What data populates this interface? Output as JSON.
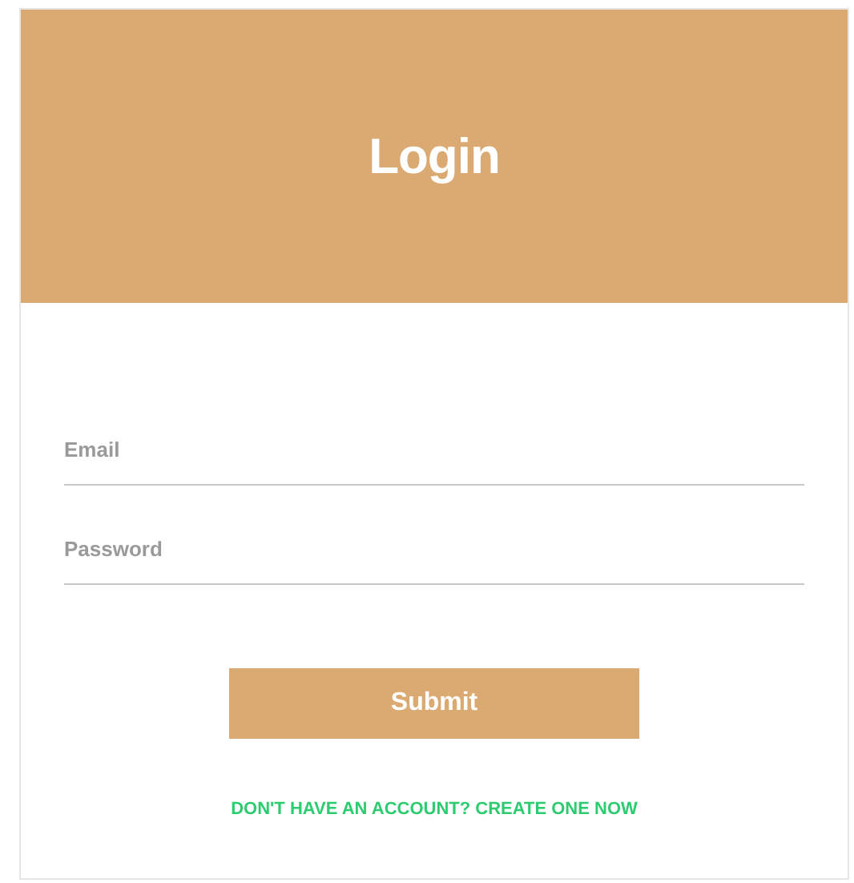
{
  "header": {
    "title": "Login"
  },
  "fields": [
    {
      "placeholder": "Email"
    },
    {
      "placeholder": "Password"
    }
  ],
  "submit": {
    "label": "Submit"
  },
  "signup_link": {
    "label": "DON'T HAVE AN ACCOUNT? CREATE ONE NOW"
  }
}
